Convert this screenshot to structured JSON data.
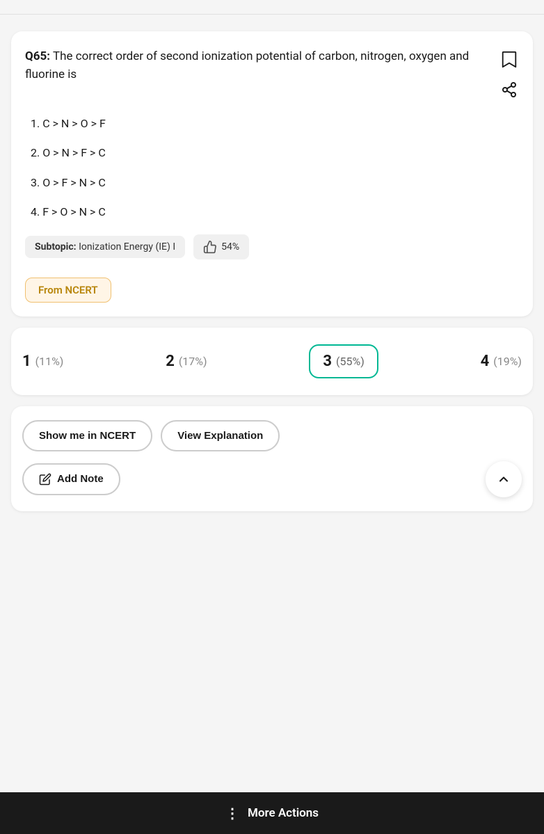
{
  "page": {
    "question_number": "Q65:",
    "question_text": "The correct order of second ionization potential of carbon, nitrogen, oxygen and fluorine is",
    "options": [
      {
        "number": "1.",
        "text": "C > N > O > F"
      },
      {
        "number": "2.",
        "text": "O > N > F > C"
      },
      {
        "number": "3.",
        "text": "O > F > N > C"
      },
      {
        "number": "4.",
        "text": "F > O > N > C"
      }
    ],
    "subtopic_label": "Subtopic:",
    "subtopic_value": "Ionization Energy (IE) I",
    "like_percent": "54%",
    "ncert_badge": "From NCERT",
    "stats": [
      {
        "option": "1",
        "percent": "(11%)",
        "selected": false
      },
      {
        "option": "2",
        "percent": "(17%)",
        "selected": false
      },
      {
        "option": "3",
        "percent": "(55%)",
        "selected": true
      },
      {
        "option": "4",
        "percent": "(19%)",
        "selected": false
      }
    ],
    "btn_ncert": "Show me in NCERT",
    "btn_explanation": "View Explanation",
    "btn_add_note": "Add Note",
    "more_actions": "More Actions"
  }
}
